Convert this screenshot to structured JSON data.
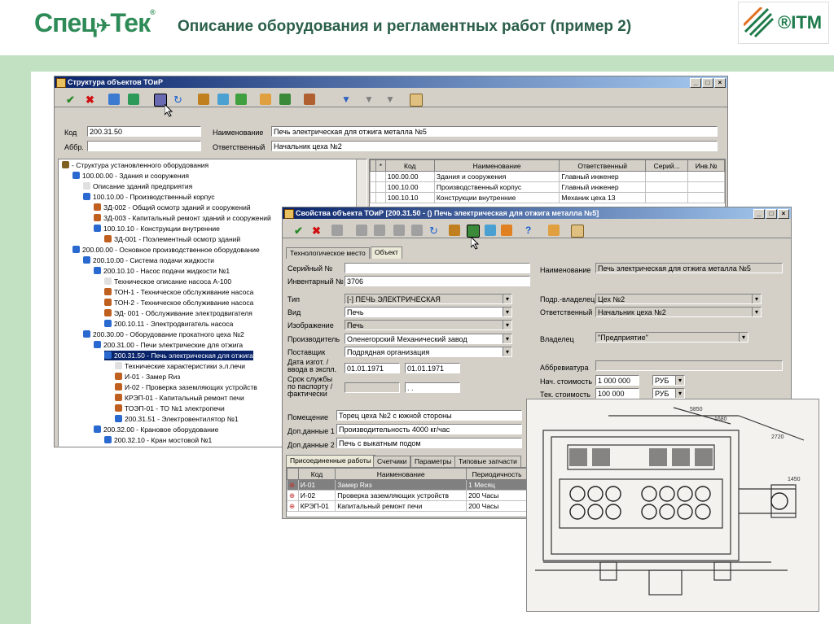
{
  "header": {
    "logo": "Спец",
    "logo2": "Тек",
    "logo_tm": "®",
    "title": "Описание оборудования и регламентных работ (пример 2)",
    "itm_logo": "®ITM"
  },
  "colors": {
    "accent": "#2e8b57",
    "band": "#c2e0c2",
    "titlebar": "#0a246a"
  },
  "win1": {
    "title": "Структура объектов ТОиР",
    "fields": {
      "kod_label": "Код",
      "kod_value": "200.31.50",
      "abbr_label": "Аббр.",
      "abbr_value": "",
      "name_label": "Наименование",
      "name_value": "Печь электрическая для отжига металла №5",
      "resp_label": "Ответственный",
      "resp_value": "Начальник цеха №2"
    },
    "tree": [
      "- Структура установленного оборудования",
      "100.00.00 - Здания и сооружения",
      "Описание зданий предприятия",
      "100.10.00 - Производственный корпус",
      "ЗД-002 - Общий осмотр зданий и сооружений",
      "ЗД-003 - Капитальный ремонт зданий и сооружений",
      "100.10.10 - Конструкции внутренние",
      "ЗД-001 - Поэлементный осмотр зданий",
      "200.00.00 - Основное производственное оборудование",
      "200.10.00 - Система подачи жидкости",
      "200.10.10 - Насос подачи жидкости №1",
      "Техническое описание насоса А-100",
      "ТОН-1 - Техническое обслуживание насоса",
      "ТОН-2 - Техническое обслуживание насоса",
      "ЭД- 001 - Обслуживание электродвигателя",
      "200.10.11 - Электродвигатель насоса",
      "200.30.00 - Оборудование прокатного цеха №2",
      "200.31.00 - Печи электрические для отжига",
      "200.31.50 - Печь электрическая для отжига",
      "Технические характеристики э.л.печи",
      "И-01 - Замер Rиз",
      "И-02 - Проверка заземляющих устройств",
      "КРЭП-01 - Капитальный ремонт печи",
      "ТОЭП-01 - ТО №1 электропечи",
      "200.31.51 - Электровентилятор №1",
      "200.32.00 - Крановое оборудование",
      "200.32.10 - Кран мостовой №1"
    ],
    "grid": {
      "headers": [
        "",
        "*",
        "Код",
        "Наименование",
        "Ответственный",
        "Серий...",
        "Инв.№"
      ],
      "rows": [
        [
          "100.00.00",
          "Здания и сооружения",
          "Главный инженер",
          "",
          ""
        ],
        [
          "100.10.00",
          "Производственный корпус",
          "Главный инженер",
          "",
          ""
        ],
        [
          "100.10.10",
          "Конструкции внутренние",
          "Механик цеха 13",
          "",
          ""
        ]
      ]
    }
  },
  "win2": {
    "title": "Свойства объекта ТОиР [200.31.50 - () Печь электрическая для отжига металла №5]",
    "tabs_top": [
      "Технологическое место",
      "Объект"
    ],
    "left": {
      "serial_label": "Серийный №",
      "serial_value": "",
      "inv_label": "Инвентарный №",
      "inv_value": "3706",
      "type_label": "Тип",
      "type_value": "[-] ПЕЧЬ ЭЛЕКТРИЧЕСКАЯ",
      "kind_label": "Вид",
      "kind_value": "Печь",
      "image_label": "Изображение",
      "image_value": "Печь",
      "maker_label": "Производитель",
      "maker_value": "Оленегорский Механический завод",
      "supplier_label": "Поставщик",
      "supplier_value": "Подрядная организация",
      "date_label": "Дата изгот. / ввода в экспл.",
      "date1": "01.01.1971",
      "date2": "01.01.1971",
      "life_label": "Срок службы по паспорту / фактически",
      "life1": "",
      "life2": ". ."
    },
    "right": {
      "name_label": "Наименование",
      "name_value": "Печь электрическая для отжига металла №5",
      "owner_sub_label": "Подр.-владелец",
      "owner_sub_value": "Цех №2",
      "resp_label": "Ответственный",
      "resp_value": "Начальник цеха №2",
      "owner_label": "Владелец",
      "owner_value": "\"Предприятие\"",
      "abbr_label": "Аббревиатура",
      "abbr_value": "",
      "cost0_label": "Нач. стоимость",
      "cost0_value": "1 000 000",
      "cost0_cur": "РУБ",
      "cost1_label": "Тек. стоимость",
      "cost1_value": "100 000",
      "cost1_cur": "РУБ"
    },
    "bottom": {
      "room_label": "Помещение",
      "room_value": "Торец цеха №2 с южной стороны",
      "add1_label": "Доп.данные 1",
      "add1_value": "Производительность 4000 кг/час",
      "add2_label": "Доп.данные 2",
      "add2_value": "Печь с выкатным подом"
    },
    "tabs_bottom": [
      "Присоединенные работы",
      "Счетчики",
      "Параметры",
      "Типовые запчасти"
    ],
    "works": {
      "headers": [
        "",
        "Код",
        "Наименование",
        "Периодичность"
      ],
      "rows": [
        [
          "И-01",
          "Замер Rиз",
          "1 Месяц"
        ],
        [
          "И-02",
          "Проверка заземляющих устройств",
          "200 Часы"
        ],
        [
          "КРЭП-01",
          "Капитальный ремонт печи",
          "200 Часы"
        ]
      ]
    }
  },
  "photo": {
    "labels": [
      "5850",
      "1680",
      "2720",
      "1450"
    ]
  }
}
